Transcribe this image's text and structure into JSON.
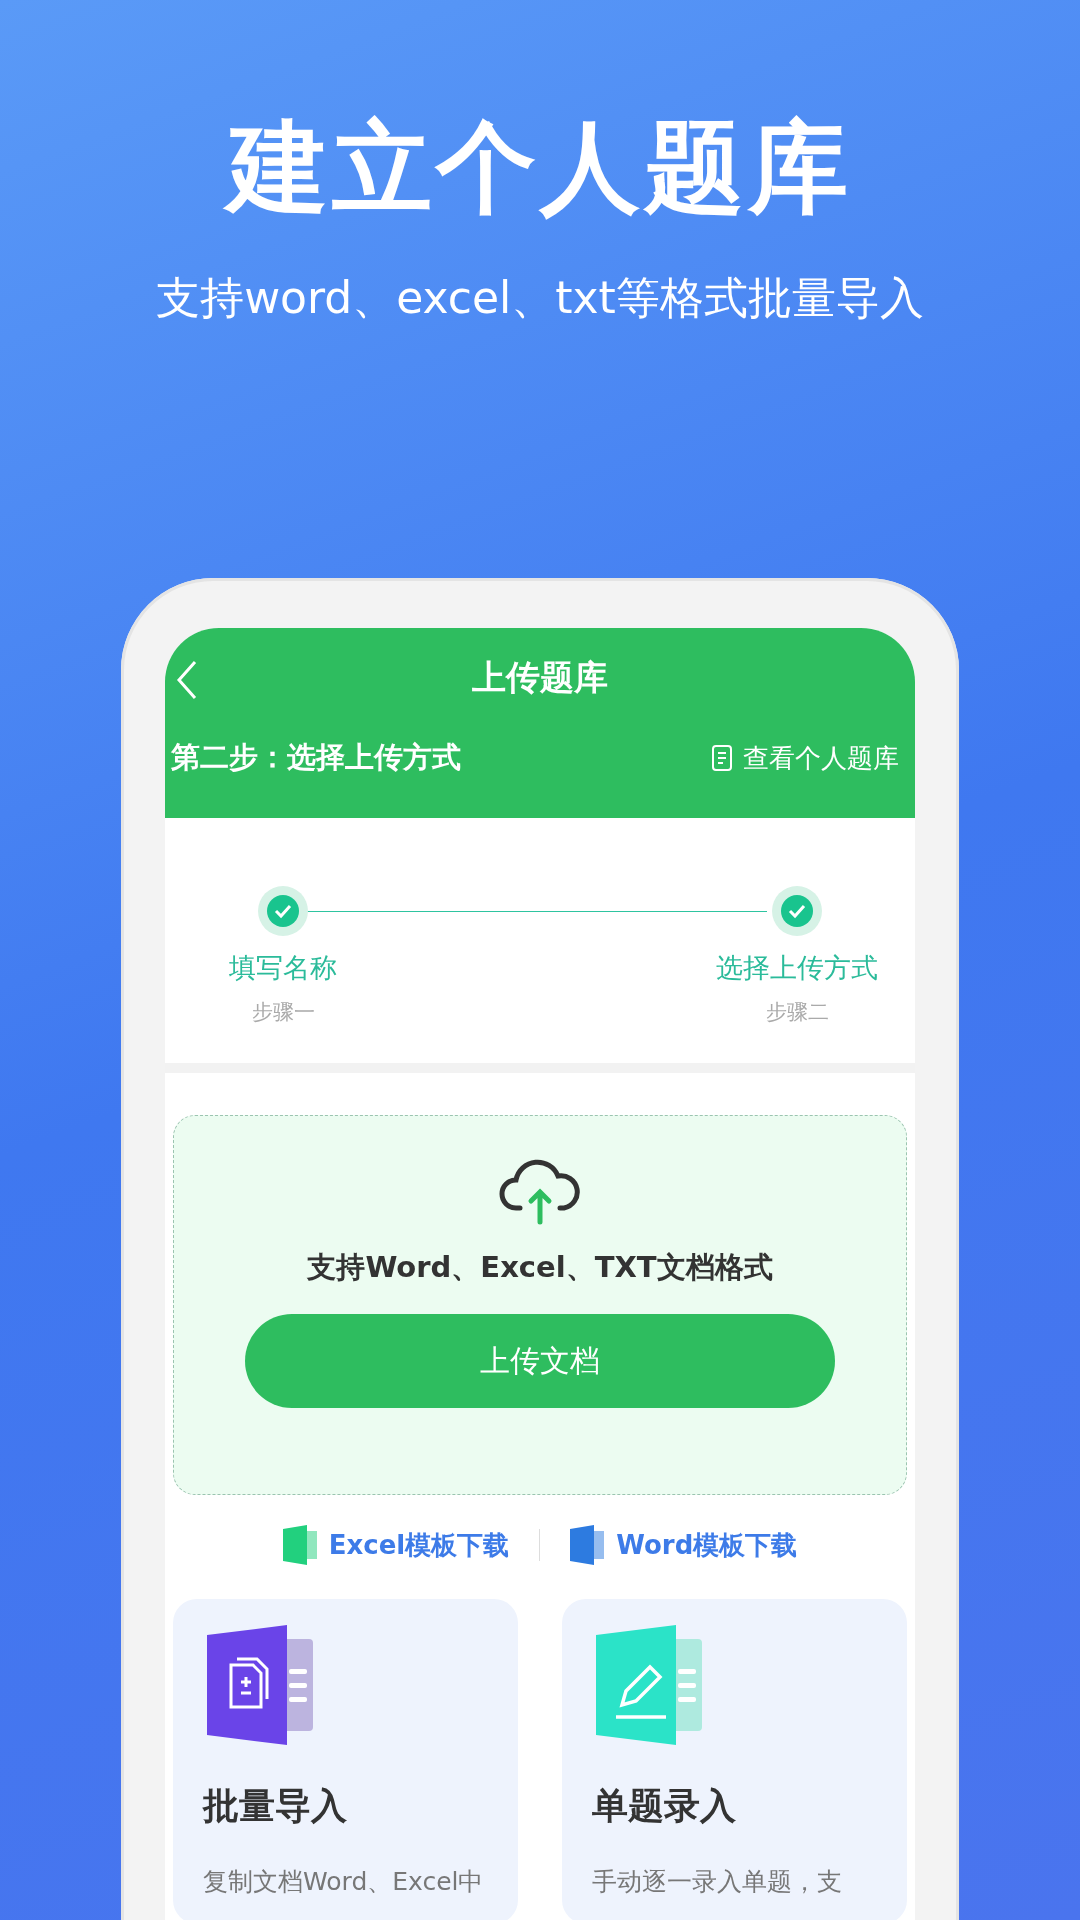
{
  "headline": "建立个人题库",
  "subtitle": "支持word、excel、txt等格式批量导入",
  "app": {
    "title": "上传题库",
    "step_heading": "第二步：选择上传方式",
    "library_link": "查看个人题库",
    "steps": [
      {
        "label": "填写名称",
        "sub": "步骤一",
        "done": true
      },
      {
        "label": "选择上传方式",
        "sub": "步骤二",
        "done": true
      }
    ],
    "upload": {
      "formats": "支持Word、Excel、TXT文档格式",
      "button": "上传文档"
    },
    "templates": [
      {
        "kind": "excel",
        "label": "Excel模板下载"
      },
      {
        "kind": "word",
        "label": "Word模板下载"
      }
    ],
    "cards": [
      {
        "kind": "batch",
        "title": "批量导入",
        "description": "复制文档Word、Excel中"
      },
      {
        "kind": "single",
        "title": "单题录入",
        "description": "手动逐一录入单题，支"
      }
    ]
  }
}
